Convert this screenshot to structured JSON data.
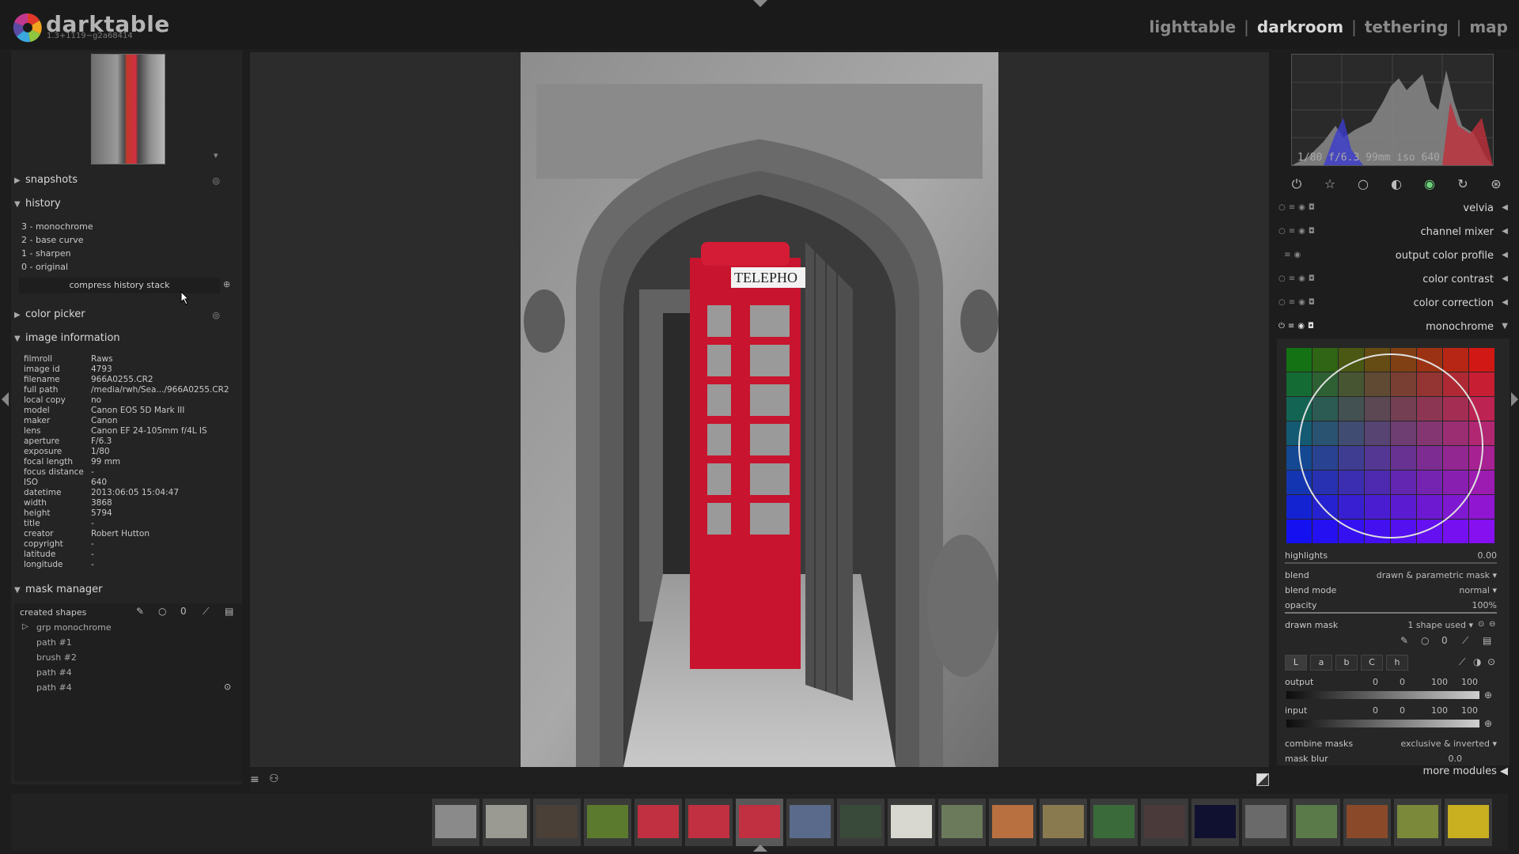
{
  "header": {
    "app_name": "darktable",
    "version": "1.3+1119~g2a68414",
    "views": [
      "lighttable",
      "darkroom",
      "tethering",
      "map"
    ],
    "active_view": "darkroom",
    "separator": "|"
  },
  "left": {
    "thumb_toggle": "▾",
    "snapshots": "snapshots",
    "history": "history",
    "history_items": [
      "3 - monochrome",
      "2 - base curve",
      "1 - sharpen",
      "0 - original"
    ],
    "compress_label": "compress history stack",
    "color_picker": "color picker",
    "image_information": "image information",
    "info_keys": [
      "filmroll",
      "image id",
      "filename",
      "full path",
      "local copy",
      "model",
      "maker",
      "lens",
      "aperture",
      "exposure",
      "focal length",
      "focus distance",
      "ISO",
      "datetime",
      "width",
      "height",
      "title",
      "creator",
      "copyright",
      "latitude",
      "longitude"
    ],
    "info_values": [
      "Raws",
      "4793",
      "966A0255.CR2",
      "/media/rwh/Sea.../966A0255.CR2",
      "no",
      "Canon EOS 5D Mark III",
      "Canon",
      "Canon EF 24-105mm f/4L IS",
      "F/6.3",
      "1/80",
      "99 mm",
      "-",
      "640",
      "2013:06:05 15:04:47",
      "3868",
      "5794",
      "-",
      "Robert Hutton",
      "-",
      "-",
      "-"
    ],
    "mask_manager": "mask manager",
    "created_shapes": "created shapes",
    "mask_group": "grp monochrome",
    "mask_items": [
      "path #1",
      "brush #2",
      "path #4",
      "path #4"
    ]
  },
  "center": {
    "sign_text": "TELEPHO"
  },
  "right": {
    "exif": "1/80 f/6.3 99mm iso 640",
    "modules": [
      "velvia",
      "channel mixer",
      "output color profile",
      "color contrast",
      "color correction",
      "monochrome"
    ],
    "highlights_label": "highlights",
    "highlights_value": "0.00",
    "blend_label": "blend",
    "blend_value": "drawn & parametric mask",
    "blend_mode_label": "blend mode",
    "blend_mode_value": "normal",
    "opacity_label": "opacity",
    "opacity_value": "100%",
    "drawn_mask_label": "drawn mask",
    "drawn_mask_value": "1 shape used",
    "channels": [
      "L",
      "a",
      "b",
      "C",
      "h"
    ],
    "output_label": "output",
    "input_label": "input",
    "range_values": [
      "0",
      "0",
      "100",
      "100"
    ],
    "combine_label": "combine masks",
    "combine_value": "exclusive & inverted",
    "mask_blur_label": "mask blur",
    "mask_blur_value": "0.0",
    "more_modules": "more modules"
  },
  "colors": {
    "accent_red": "#d0283c",
    "panel_bg": "#242424",
    "text": "#c8c8c8"
  },
  "icons": [
    "power-icon",
    "favorite-icon",
    "basic-icon",
    "tone-icon",
    "color-icon",
    "correct-icon",
    "effect-icon"
  ]
}
